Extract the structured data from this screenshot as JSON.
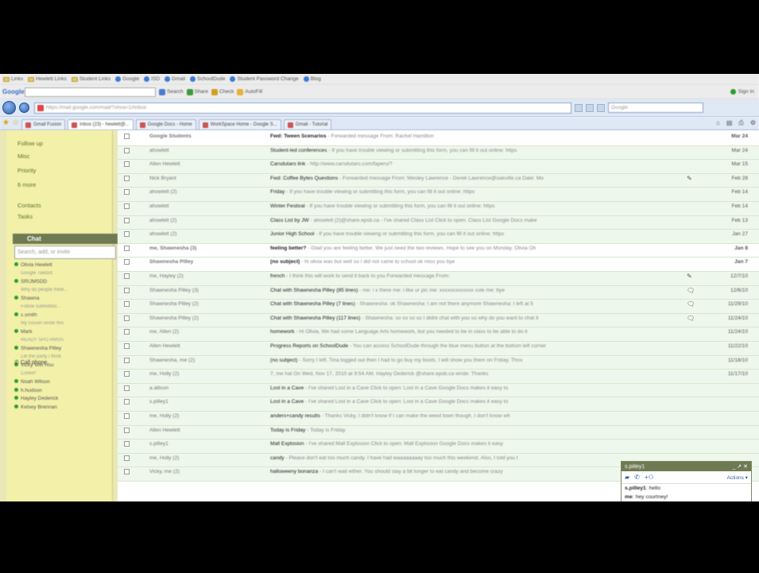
{
  "links_bar": [
    "Links",
    "Hewlett Links",
    "Student Links",
    "Google",
    "ISD",
    "Gmail",
    "SchoolDude",
    "Student Password Change",
    "Blog"
  ],
  "google_bar": {
    "logo": "Google",
    "search": "Search",
    "share": "Share",
    "check": "Check",
    "autofill": "AutoFill",
    "signin": "Sign In"
  },
  "address_bar": {
    "url": "https://mail.google.com/mail/?shva=1#inbox",
    "search_placeholder": "Google"
  },
  "tabs": [
    "Gmail Fusion",
    "Inbox (23) - hewlett@...",
    "Google Docs - Home",
    "WorkSpace Home - Google S...",
    "Gmail - Tutorial"
  ],
  "sidebar": {
    "links": [
      "Follow up",
      "Misc",
      "Priority",
      "6 more",
      "Contacts",
      "Tasks"
    ],
    "chat_title": "Chat",
    "chat_search_placeholder": "Search, add, or invite",
    "call_phone": "Call phone",
    "contacts": [
      {
        "name": "Olivia Hewlett",
        "status": false
      },
      {
        "name": "Google Talkbot",
        "status": true
      },
      {
        "name": "SRIJMSDD",
        "status": false
      },
      {
        "name": "Why do people think...",
        "status": true
      },
      {
        "name": "Shawna",
        "status": false
      },
      {
        "name": "Follow submitted...",
        "status": true
      },
      {
        "name": "c.smith",
        "status": false
      },
      {
        "name": "My cousin wrote this",
        "status": true
      },
      {
        "name": "Mark",
        "status": false
      },
      {
        "name": "READY SPO RMSS",
        "status": true
      },
      {
        "name": "Shawnesha Pilley",
        "status": false
      },
      {
        "name": "Let the party I think",
        "status": true
      },
      {
        "name": "Vicky Wei Hsu",
        "status": false
      },
      {
        "name": "Cookin'",
        "status": true
      },
      {
        "name": "Noah Wilson",
        "status": false
      },
      {
        "name": "h.hudson",
        "status": false
      },
      {
        "name": "Hayley Dederick",
        "status": false
      },
      {
        "name": "Kelsey Brennan",
        "status": false
      }
    ]
  },
  "mail_rows": [
    {
      "sender": "Google Students",
      "subject": "Fwd: Tween Scenarios",
      "snippet": " - Forwarded message From: Rachel Hamilton",
      "date": "Mar 24",
      "unread": true,
      "icon": ""
    },
    {
      "sender": "ahowlett",
      "subject": "Student-led conferences",
      "snippet": " - If you have trouble viewing or submitting this form, you can fill it out online: https",
      "date": "Mar 24",
      "unread": false,
      "icon": ""
    },
    {
      "sender": "Allen Hewlett",
      "subject": "Carsdutaro link",
      "snippet": " - http://www.carsdutaro.com/fapers/?",
      "date": "Mar 15",
      "unread": false,
      "icon": ""
    },
    {
      "sender": "Nick Bryant",
      "subject": "Fwd: Coffee Bytes Questions",
      "snippet": " - Forwarded message From: Wesley Lawrence - Derek Lawrence@oakville.ca Date: Mo",
      "date": "Feb 28",
      "unread": false,
      "icon": "✎"
    },
    {
      "sender": "ahowlett (2)",
      "subject": "Friday",
      "snippet": " - If you have trouble viewing or submitting this form, you can fill it out online: https",
      "date": "Feb 14",
      "unread": false,
      "icon": ""
    },
    {
      "sender": "ahowlett",
      "subject": "Winter Festival",
      "snippet": " - If you have trouble viewing or submitting this form, you can fill it out online: https",
      "date": "Feb 14",
      "unread": false,
      "icon": ""
    },
    {
      "sender": "ahowlett (2)",
      "subject": "Class List by JW",
      "snippet": " - ahowlett (2)@share.epsb.ca - I've shared Class List Click to open: Class List Google Docs make",
      "date": "Feb 13",
      "unread": false,
      "icon": ""
    },
    {
      "sender": "ahowlett (2)",
      "subject": "Junior High School",
      "snippet": " - If you have trouble viewing or submitting this form, you can fill it out online: https",
      "date": "Jan 27",
      "unread": false,
      "icon": ""
    },
    {
      "sender": "me, Shawnesha (3)",
      "subject": "feeling better?",
      "snippet": " - Glad you are feeling better. We just need the two reviews. Hope to see you on Monday. Olivia Oh",
      "date": "Jan 8",
      "unread": true,
      "icon": ""
    },
    {
      "sender": "Shawnesha Pilley",
      "subject": "(no subject)",
      "snippet": " - hi olivia was but well so I did not came to school ok miss you bye",
      "date": "Jan 7",
      "unread": true,
      "icon": ""
    },
    {
      "sender": "me, Hayley (2)",
      "subject": "french",
      "snippet": " - I think this will work to send it back to you Forwarded message From:",
      "date": "12/7/10",
      "unread": false,
      "icon": "✎"
    },
    {
      "sender": "Shawnesha Pilley (3)",
      "subject": "Chat with Shawnesha Pilley (85 lines)",
      "snippet": " - me: i x there me: i like ur pic me: xxxxxxxxxxxxx cole me: bye",
      "date": "12/6/10",
      "unread": false,
      "icon": "🗨"
    },
    {
      "sender": "Shawnesha Pilley (2)",
      "subject": "Chat with Shawnesha Pilley (7 lines)",
      "snippet": " - Shawnesha: ok Shawnesha: I am not there anymore Shawnesha: I left at 5",
      "date": "11/29/10",
      "unread": false,
      "icon": "🗨"
    },
    {
      "sender": "Shawnesha Pilley (2)",
      "subject": "Chat with Shawnesha Pilley (117 lines)",
      "snippet": " - Shawnesha: so so so so I didnt chat with you so why do you want to chat it",
      "date": "11/24/10",
      "unread": false,
      "icon": "🗨"
    },
    {
      "sender": "me, Allen (2)",
      "subject": "homework",
      "snippet": " - Hi Olivia, We had some Language Arts homework, but you needed to be in class to be able to do it",
      "date": "11/24/10",
      "unread": false,
      "icon": ""
    },
    {
      "sender": "Allen Hewlett",
      "subject": "Progress Reports on SchoolDude",
      "snippet": " - You can access SchoolDude through the blue menu button at the bottom left corner",
      "date": "11/22/10",
      "unread": false,
      "icon": ""
    },
    {
      "sender": "Shawnesha, me (2)",
      "subject": "(no subject)",
      "snippet": " - Sorry I left. Tina logged out then I had to go buy my boots. I will show you them on Friday. Thnx",
      "date": "11/18/10",
      "unread": false,
      "icon": ""
    },
    {
      "sender": "me, Holly (2)",
      "subject": "",
      "snippet": "7, me hat On Wed, Nov 17, 2010 at 9:54 AM, Hayley Dederick @share.epsb.ca wrote: Thanks",
      "date": "11/17/10",
      "unread": false,
      "icon": ""
    },
    {
      "sender": "a.allison",
      "subject": "Lost in a Cave",
      "snippet": " - I've shared Lost in a Cave Click to open: Lost in a Cave Google Docs makes it easy to",
      "date": "",
      "unread": false,
      "icon": ""
    },
    {
      "sender": "s.pilley1",
      "subject": "Lost in a Cave",
      "snippet": " - I've shared Lost in a Cave Click to open: Lost in a Cave Google Docs makes it easy to",
      "date": "",
      "unread": false,
      "icon": ""
    },
    {
      "sender": "me, Holly (2)",
      "subject": "anders+candy results",
      "snippet": " - Thanks Vicky, I didn't know if I can make the weed town though. I don't know wh",
      "date": "",
      "unread": false,
      "icon": ""
    },
    {
      "sender": "Allen Hewlett",
      "subject": "Today is Friday",
      "snippet": " - Today is Friday",
      "date": "",
      "unread": false,
      "icon": ""
    },
    {
      "sender": "s.pilley1",
      "subject": "Mall Explosion",
      "snippet": " - I've shared Mall Explosion Click to open: Mall Explosion Google Docs makes it easy",
      "date": "",
      "unread": false,
      "icon": ""
    },
    {
      "sender": "me, Holly (2)",
      "subject": "candy",
      "snippet": " - Please don't eat too much candy. I have had waaaaaaaay too much this weekend. Also, I told you t",
      "date": "",
      "unread": false,
      "icon": ""
    },
    {
      "sender": "Vicky, me (2)",
      "subject": "halloweeny bonanza",
      "snippet": " - I can't wait either. You should stay a bit longer to eat candy and become crazy",
      "date": "",
      "unread": false,
      "icon": ""
    }
  ],
  "chat_window": {
    "contact": "s.pilley1",
    "actions": "Actions ▾",
    "messages": [
      {
        "who": "s.pilley1",
        "text": "hello"
      },
      {
        "who": "me",
        "text": "hey courtney!"
      }
    ]
  },
  "colors": {
    "sidebar": "#f3f1a9",
    "chat_header": "#6f7a52",
    "read_row": "#eef7ec"
  }
}
